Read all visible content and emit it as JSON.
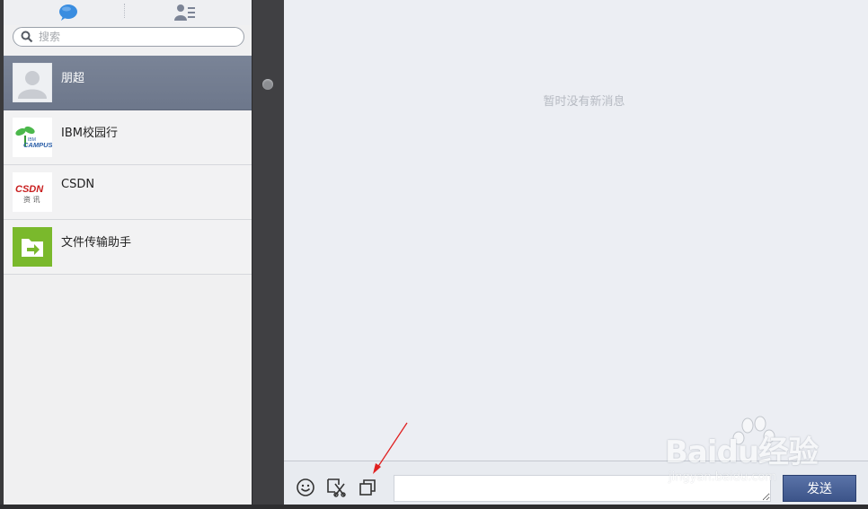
{
  "left_panel": {
    "tabs": [
      {
        "icon": "chat-bubble-icon",
        "active": true
      },
      {
        "icon": "contacts-icon",
        "active": false
      }
    ],
    "search": {
      "placeholder": "搜索",
      "value": ""
    },
    "conversations": [
      {
        "name": "朋超",
        "avatar": "default-user-avatar",
        "active": true
      },
      {
        "name": "IBM校园行",
        "avatar": "ibm-campus-logo",
        "logo_text": [
          "IBM",
          "CAMPUS"
        ],
        "active": false
      },
      {
        "name": "CSDN",
        "avatar": "csdn-logo",
        "logo_text": [
          "CSDN",
          "资 讯"
        ],
        "active": false
      },
      {
        "name": "文件传输助手",
        "avatar": "file-transfer-icon",
        "active": false
      }
    ]
  },
  "right_panel": {
    "empty_message": "暂时没有新消息",
    "toolbar": {
      "tools": [
        "emoji-icon",
        "screenshot-icon",
        "window-icon"
      ],
      "input_value": "",
      "send_label": "发送"
    }
  },
  "watermark": {
    "brand": "Baidu经验",
    "url": "jingyan.baidu.com"
  },
  "colors": {
    "active_item": "#727c90",
    "send_button": "#3c5489",
    "annotation_arrow": "#e02020"
  }
}
